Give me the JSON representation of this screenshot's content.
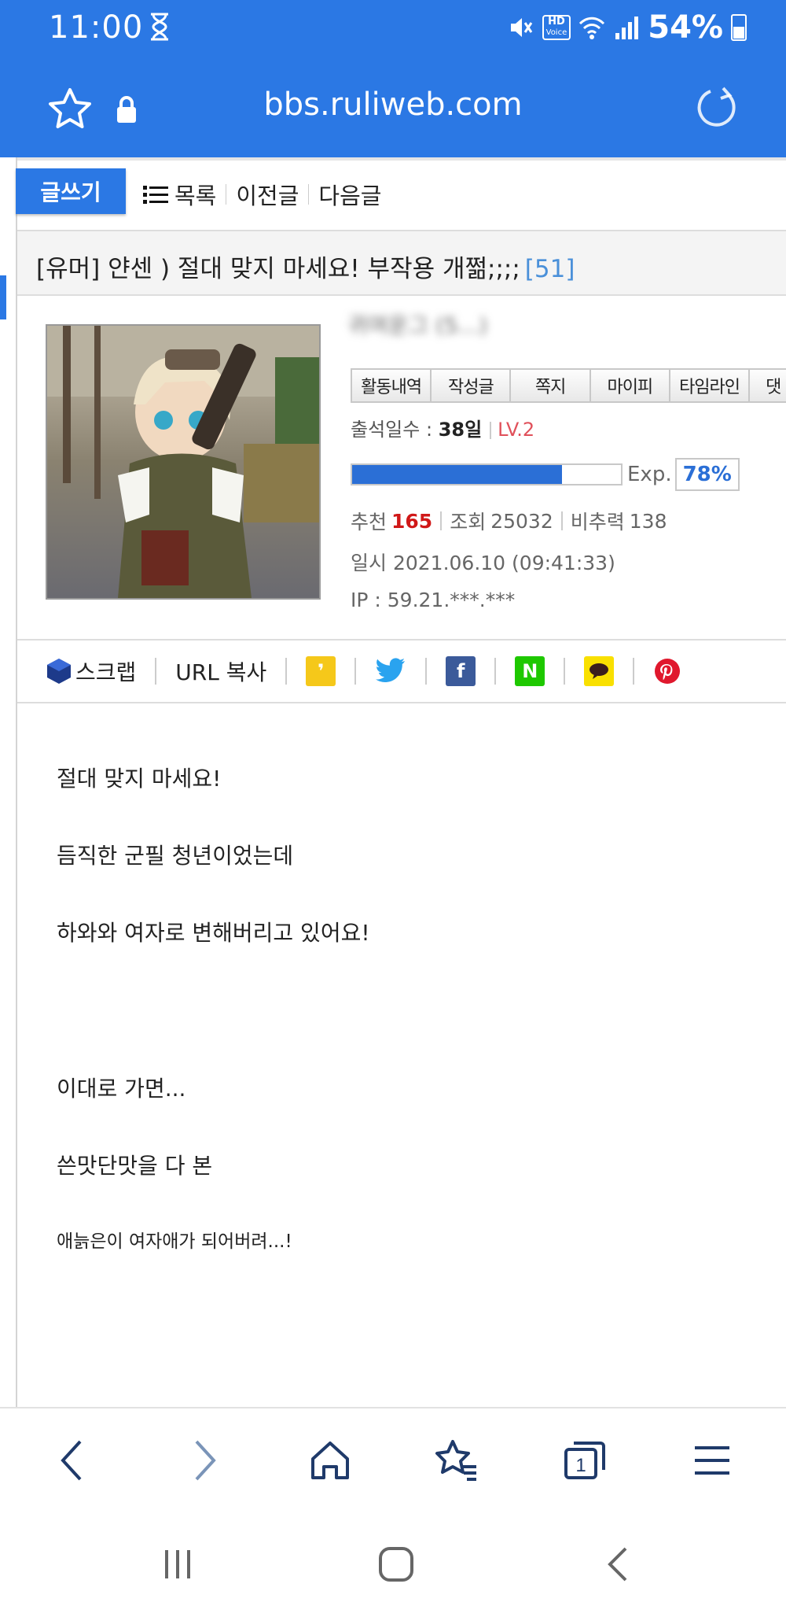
{
  "status": {
    "time": "11:00",
    "battery": "54%",
    "hd_label": "HD",
    "hd_sub": "Voice"
  },
  "browser": {
    "url": "bbs.ruliweb.com"
  },
  "actions": {
    "write": "글쓰기",
    "list": "목록",
    "prev": "이전글",
    "next": "다음글"
  },
  "post": {
    "title": "[유머] 얀센 ) 절대 맞지 마세요! 부작용 개쩖;;;;",
    "comment_count": "[51]",
    "author_blurred": "귀여운그 (5...)",
    "tabs": [
      "활동내역",
      "작성글",
      "쪽지",
      "마이피",
      "타임라인",
      "댓"
    ],
    "attendance_label": "출석일수 :",
    "attendance_value": "38일",
    "level": "LV.2",
    "exp_label": "Exp.",
    "exp_percent": "78%",
    "exp_fraction": 0.78,
    "recommend_label": "추천",
    "recommend_value": "165",
    "views_label": "조회",
    "views_value": "25032",
    "nonrec_label": "비추력",
    "nonrec_value": "138",
    "date": "일시 2021.06.10 (09:41:33)",
    "ip": "IP : 59.21.***.***"
  },
  "share": {
    "scrap": "스크랩",
    "url_copy": "URL 복사"
  },
  "content": {
    "lines": [
      "절대 맞지 마세요!",
      "듬직한 군필 청년이었는데",
      "하와와 여자로 변해버리고 있어요!",
      "이대로 가면...",
      "쓴맛단맛을 다 본",
      "애늙은이 여자애가 되어버려...!"
    ]
  },
  "colors": {
    "brand_blue": "#2b78e4",
    "exp_blue": "#2b6fd6",
    "level_red": "#e0505a",
    "recommend_red": "#d01818"
  },
  "tab_count_badge": "1"
}
